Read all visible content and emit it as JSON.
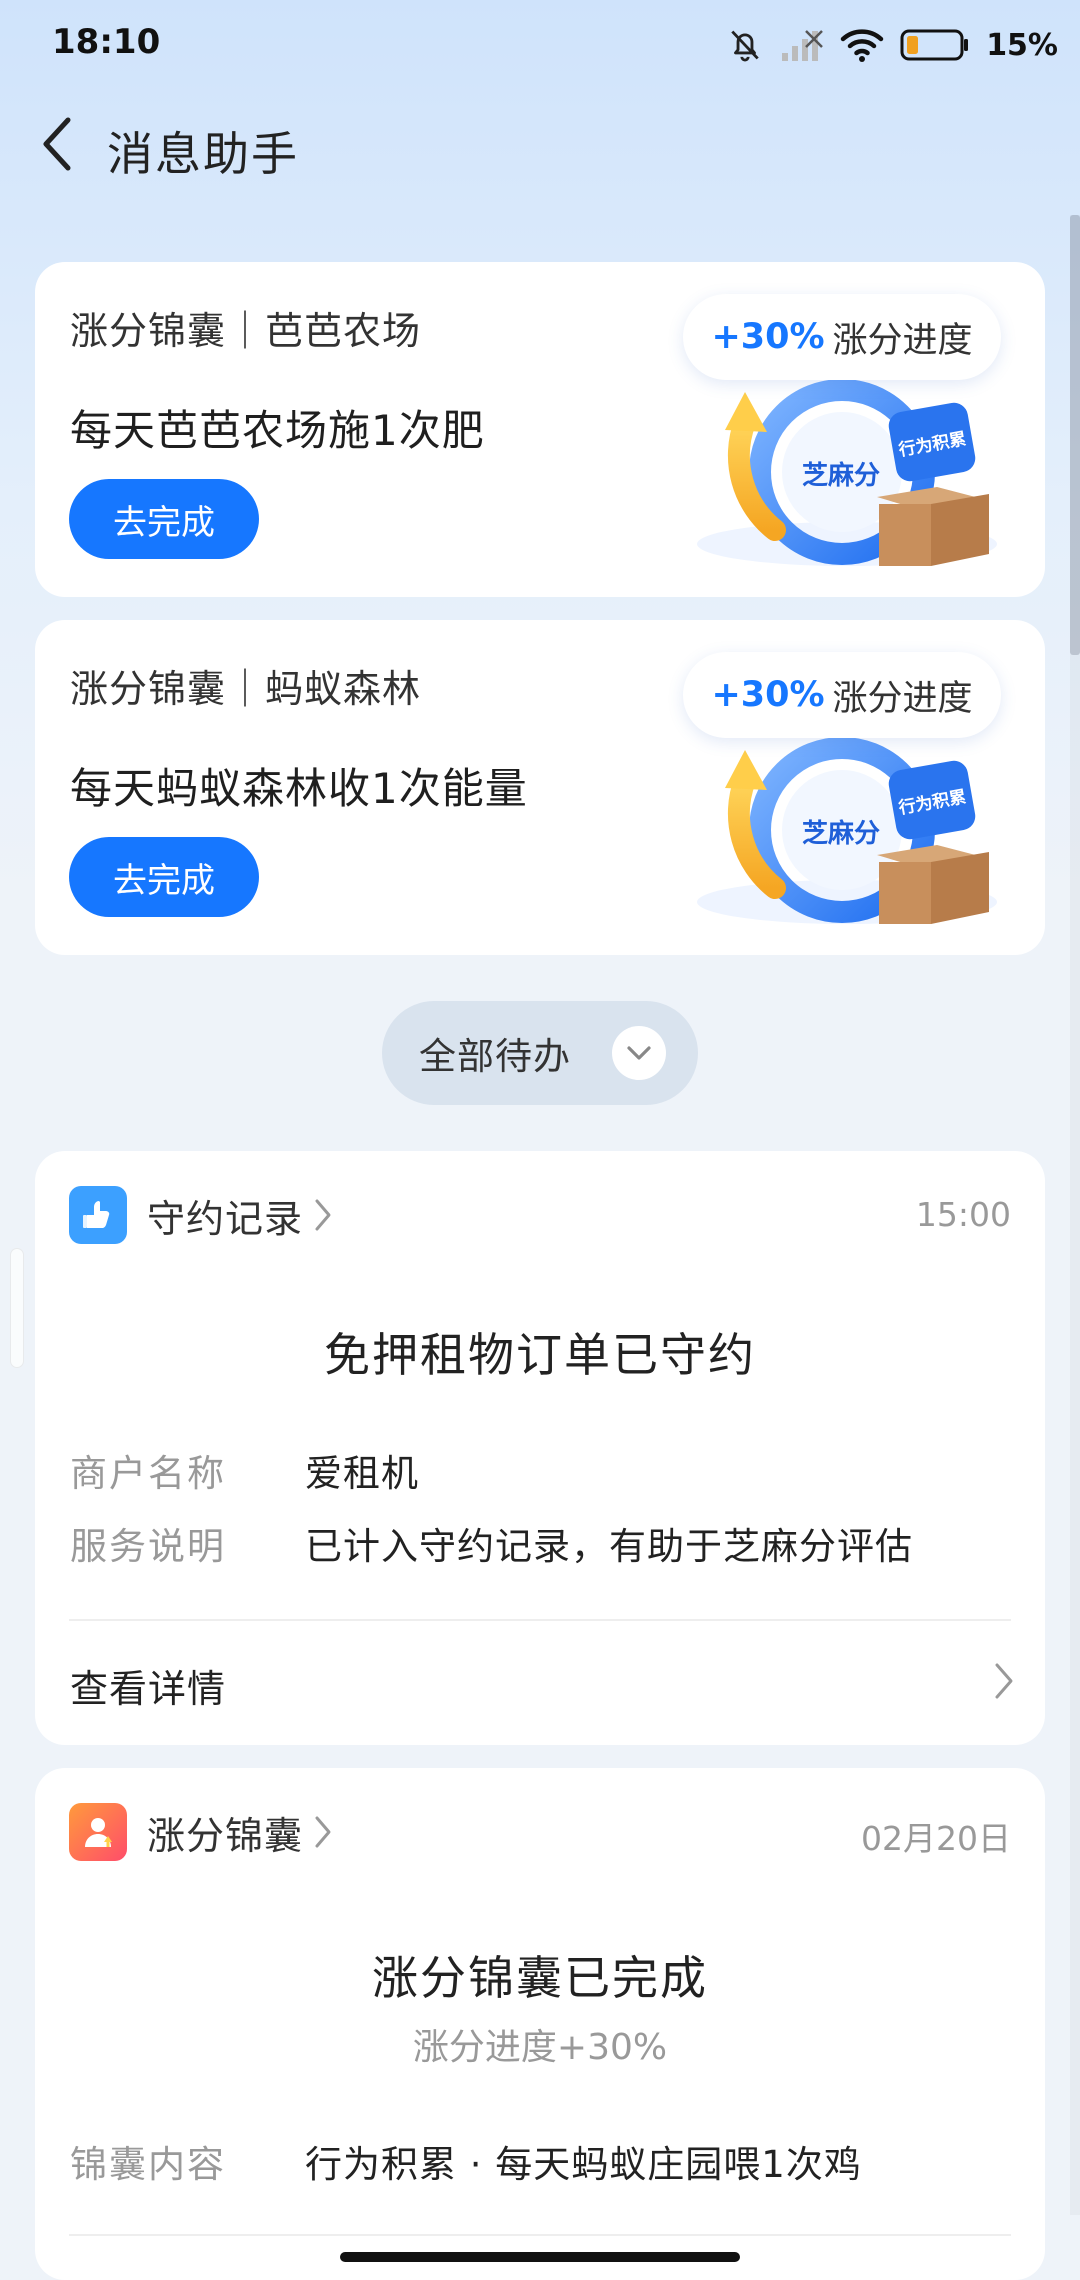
{
  "status_bar": {
    "time": "18:10",
    "battery": "15%"
  },
  "nav": {
    "title": "消息助手"
  },
  "tasks": [
    {
      "tag": "涨分锦囊｜芭芭农场",
      "desc": "每天芭芭农场施1次肥",
      "button": "去完成",
      "progress_pct": "+30%",
      "progress_label": "涨分进度",
      "ring_label": "芝麻分",
      "box_label": "行为积累"
    },
    {
      "tag": "涨分锦囊｜蚂蚁森林",
      "desc": "每天蚂蚁森林收1次能量",
      "button": "去完成",
      "progress_pct": "+30%",
      "progress_label": "涨分进度",
      "ring_label": "芝麻分",
      "box_label": "行为积累"
    }
  ],
  "all_todo": {
    "label": "全部待办"
  },
  "records": [
    {
      "app_name": "守约记录",
      "time": "15:00",
      "title": "免押租物订单已守约",
      "rows": [
        {
          "label": "商户名称",
          "value": "爱租机"
        },
        {
          "label": "服务说明",
          "value": "已计入守约记录，有助于芝麻分评估"
        }
      ],
      "detail_link": "查看详情"
    },
    {
      "app_name": "涨分锦囊",
      "time": "02月20日",
      "title": "涨分锦囊已完成",
      "subtitle": "涨分进度+30%",
      "rows": [
        {
          "label": "锦囊内容",
          "value": "行为积累 · 每天蚂蚁庄园喂1次鸡"
        }
      ]
    }
  ],
  "colors": {
    "primary_blue": "#1677ff",
    "background": "#eef3f9",
    "card": "#ffffff",
    "progress_ring_blue": "#2f7bf2",
    "arrow_yellow": "#f5c343"
  },
  "icons": [
    "bell-muted-icon",
    "signal-icon",
    "wifi-icon",
    "battery-icon",
    "back-icon",
    "chevron-down-icon",
    "chevron-right-icon",
    "thumbs-up-app-icon",
    "trophy-app-icon"
  ]
}
